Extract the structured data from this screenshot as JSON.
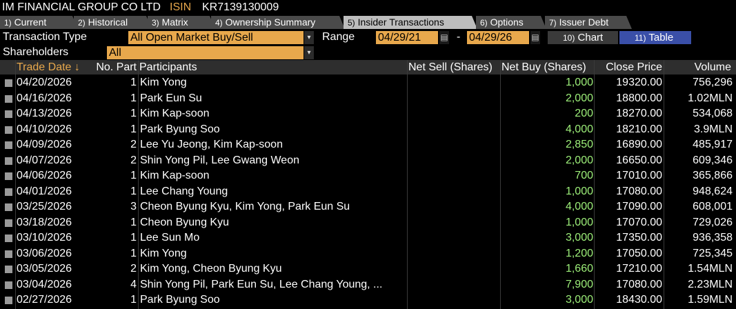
{
  "title": {
    "company": "IM FINANCIAL GROUP CO LTD",
    "isin_label": "ISIN",
    "isin": "KR7139130009"
  },
  "tabs": [
    {
      "num": "1)",
      "label": "Current"
    },
    {
      "num": "2)",
      "label": "Historical"
    },
    {
      "num": "3)",
      "label": "Matrix"
    },
    {
      "num": "4)",
      "label": "Ownership Summary"
    },
    {
      "num": "5)",
      "label": "Insider Transactions"
    },
    {
      "num": "6)",
      "label": "Options"
    },
    {
      "num": "7)",
      "label": "Issuer Debt"
    }
  ],
  "filters": {
    "transaction_type_label": "Transaction Type",
    "transaction_type_value": "All Open Market Buy/Sell",
    "range_label": "Range",
    "date_from": "04/29/21",
    "date_sep": "-",
    "date_to": "04/29/26",
    "shareholders_label": "Shareholders",
    "shareholders_value": "All"
  },
  "view_buttons": [
    {
      "num": "10)",
      "label": "Chart"
    },
    {
      "num": "11)",
      "label": "Table"
    }
  ],
  "columns": {
    "trade_date": "Trade Date ↓",
    "no_part": "No. Part",
    "participants": "Participants",
    "net_sell": "Net Sell (Shares)",
    "net_buy": "Net Buy (Shares)",
    "close_price": "Close Price",
    "volume": "Volume"
  },
  "colors": {
    "accent_orange": "#e8a84c",
    "buy_green": "#9ef07a",
    "table_button": "#3a4fa8",
    "active_tab": "#bdbdbd"
  },
  "rows": [
    {
      "date": "04/20/2026",
      "no": "1",
      "participants": "Kim Yong",
      "net_sell": "",
      "net_buy": "1,000",
      "close": "19320.00",
      "volume": "756,296"
    },
    {
      "date": "04/16/2026",
      "no": "1",
      "participants": "Park Eun Su",
      "net_sell": "",
      "net_buy": "2,000",
      "close": "18800.00",
      "volume": "1.02MLN"
    },
    {
      "date": "04/13/2026",
      "no": "1",
      "participants": "Kim Kap-soon",
      "net_sell": "",
      "net_buy": "200",
      "close": "18270.00",
      "volume": "534,068"
    },
    {
      "date": "04/10/2026",
      "no": "1",
      "participants": "Park Byung Soo",
      "net_sell": "",
      "net_buy": "4,000",
      "close": "18210.00",
      "volume": "3.9MLN"
    },
    {
      "date": "04/09/2026",
      "no": "2",
      "participants": "Lee Yu Jeong, Kim Kap-soon",
      "net_sell": "",
      "net_buy": "2,850",
      "close": "16890.00",
      "volume": "485,917"
    },
    {
      "date": "04/07/2026",
      "no": "2",
      "participants": "Shin Yong Pil, Lee Gwang Weon",
      "net_sell": "",
      "net_buy": "2,000",
      "close": "16650.00",
      "volume": "609,346"
    },
    {
      "date": "04/06/2026",
      "no": "1",
      "participants": "Kim Kap-soon",
      "net_sell": "",
      "net_buy": "700",
      "close": "17010.00",
      "volume": "365,866"
    },
    {
      "date": "04/01/2026",
      "no": "1",
      "participants": "Lee Chang Young",
      "net_sell": "",
      "net_buy": "1,000",
      "close": "17080.00",
      "volume": "948,624"
    },
    {
      "date": "03/25/2026",
      "no": "3",
      "participants": "Cheon Byung Kyu, Kim Yong, Park Eun Su",
      "net_sell": "",
      "net_buy": "4,000",
      "close": "17090.00",
      "volume": "608,001"
    },
    {
      "date": "03/18/2026",
      "no": "1",
      "participants": "Cheon Byung Kyu",
      "net_sell": "",
      "net_buy": "1,000",
      "close": "17070.00",
      "volume": "729,026"
    },
    {
      "date": "03/10/2026",
      "no": "1",
      "participants": "Lee Sun Mo",
      "net_sell": "",
      "net_buy": "3,000",
      "close": "17350.00",
      "volume": "936,358"
    },
    {
      "date": "03/06/2026",
      "no": "1",
      "participants": "Kim Yong",
      "net_sell": "",
      "net_buy": "1,200",
      "close": "17050.00",
      "volume": "725,345"
    },
    {
      "date": "03/05/2026",
      "no": "2",
      "participants": "Kim Yong, Cheon Byung Kyu",
      "net_sell": "",
      "net_buy": "1,660",
      "close": "17210.00",
      "volume": "1.54MLN"
    },
    {
      "date": "03/04/2026",
      "no": "4",
      "participants": "Shin Yong Pil, Park Eun Su, Lee Chang Young, ...",
      "net_sell": "",
      "net_buy": "7,900",
      "close": "17080.00",
      "volume": "2.23MLN"
    },
    {
      "date": "02/27/2026",
      "no": "1",
      "participants": "Park Byung Soo",
      "net_sell": "",
      "net_buy": "3,000",
      "close": "18430.00",
      "volume": "1.59MLN"
    }
  ]
}
